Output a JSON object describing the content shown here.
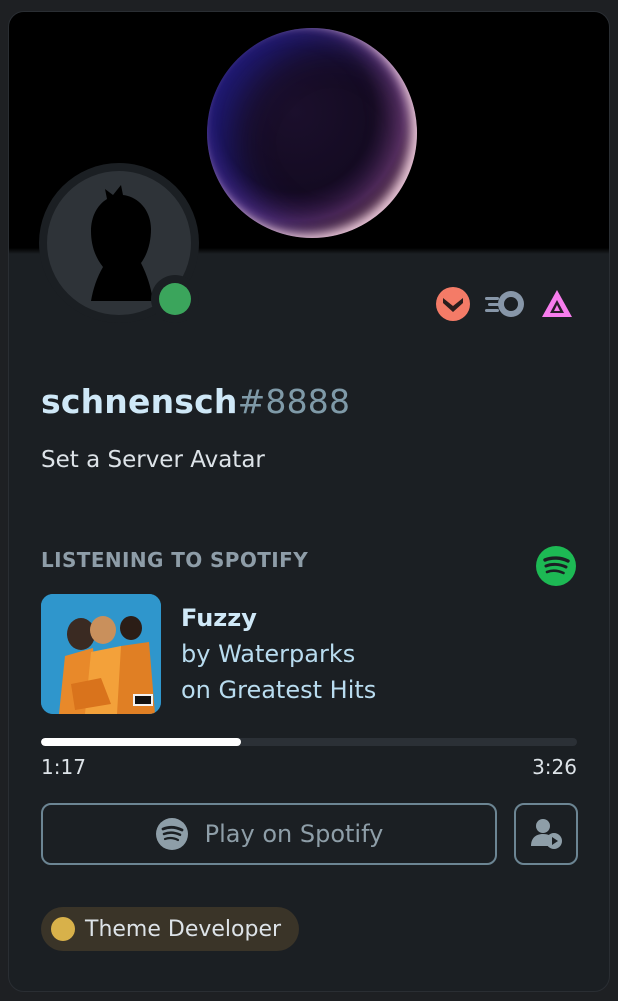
{
  "user": {
    "username": "schnensch",
    "discriminator": "#8888",
    "status": "online",
    "custom_status": "Set a Server Avatar",
    "avatar_icon": "silhouette-avatar-icon"
  },
  "badges": [
    {
      "icon": "hypesquad-bravery-icon",
      "color": "#f47b67"
    },
    {
      "icon": "nitro-boost-icon",
      "color": "#8796a8"
    },
    {
      "icon": "hypesquad-balance-triangle-icon",
      "color": "#f77ded"
    }
  ],
  "activity": {
    "header": "LISTENING TO SPOTIFY",
    "service_icon": "spotify-icon",
    "track": {
      "title": "Fuzzy",
      "artist_line": "by Waterparks",
      "album_line": "on Greatest Hits"
    },
    "progress": {
      "elapsed": "1:17",
      "duration": "3:26",
      "fraction": 0.374
    },
    "play_button_label": "Play on Spotify",
    "profile_button_icon": "user-play-icon"
  },
  "roles": [
    {
      "name": "Theme Developer",
      "color": "#d8b14a"
    }
  ],
  "colors": {
    "spotify_green": "#1db954",
    "online_green": "#3ba55c",
    "username": "#cfe8f7"
  }
}
